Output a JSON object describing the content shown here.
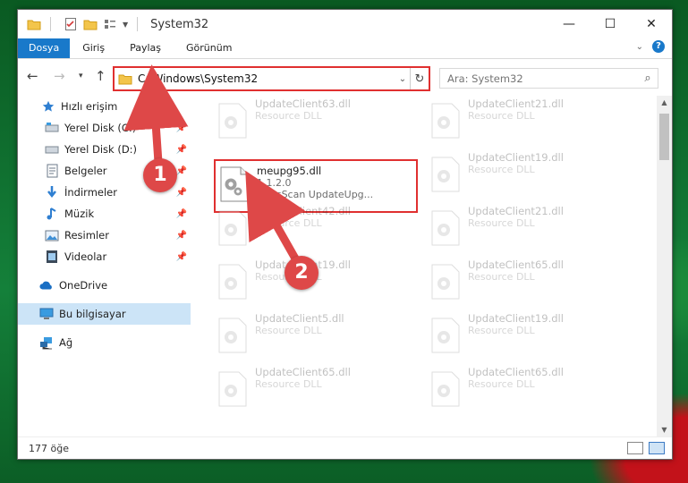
{
  "window": {
    "title": "System32"
  },
  "ribbon": {
    "tabs": [
      "Dosya",
      "Giriş",
      "Paylaş",
      "Görünüm"
    ]
  },
  "address": {
    "path": "C:\\Windows\\System32"
  },
  "search": {
    "placeholder": "Ara: System32"
  },
  "nav": {
    "items": [
      {
        "label": "Hızlı erişim",
        "icon": "star-icon",
        "pinned": false
      },
      {
        "label": "Yerel Disk (C:)",
        "icon": "drive-icon",
        "pinned": true
      },
      {
        "label": "Yerel Disk (D:)",
        "icon": "drive-icon",
        "pinned": true
      },
      {
        "label": "Belgeler",
        "icon": "documents-icon",
        "pinned": true
      },
      {
        "label": "İndirmeler",
        "icon": "downloads-icon",
        "pinned": true
      },
      {
        "label": "Müzik",
        "icon": "music-icon",
        "pinned": true
      },
      {
        "label": "Resimler",
        "icon": "pictures-icon",
        "pinned": true
      },
      {
        "label": "Videolar",
        "icon": "videos-icon",
        "pinned": true
      },
      {
        "label": "OneDrive",
        "icon": "onedrive-icon",
        "pinned": false
      },
      {
        "label": "Bu bilgisayar",
        "icon": "computer-icon",
        "pinned": false
      },
      {
        "label": "Ağ",
        "icon": "network-icon",
        "pinned": false
      }
    ]
  },
  "files": {
    "highlighted": {
      "name": "meupg95.dll",
      "version": "1.1.2.0",
      "description": "VirusScan UpdateUpg..."
    },
    "faded": [
      {
        "name": "UpdateClient63.dll",
        "description": "Resource DLL"
      },
      {
        "name": "UpdateClient21.dll",
        "description": "Resource DLL"
      },
      {
        "name": "UpdateClient19.dll",
        "description": "Resource DLL"
      },
      {
        "name": "UpdateClient42.dll",
        "description": "Resource DLL"
      },
      {
        "name": "UpdateClient21.dll",
        "description": "Resource DLL"
      },
      {
        "name": "UpdateClient19.dll",
        "description": "Resource DLL"
      },
      {
        "name": "UpdateClient65.dll",
        "description": "Resource DLL"
      },
      {
        "name": "UpdateClient5.dll",
        "description": "Resource DLL"
      },
      {
        "name": "UpdateClient19.dll",
        "description": "Resource DLL"
      },
      {
        "name": "UpdateClient65.dll",
        "description": "Resource DLL"
      },
      {
        "name": "UpdateClient65.dll",
        "description": "Resource DLL"
      }
    ]
  },
  "status": {
    "count": "177 öğe"
  },
  "callouts": [
    "1",
    "2"
  ],
  "colors": {
    "accent": "#1979ca",
    "highlight": "#e03030",
    "callout": "#de4848"
  }
}
